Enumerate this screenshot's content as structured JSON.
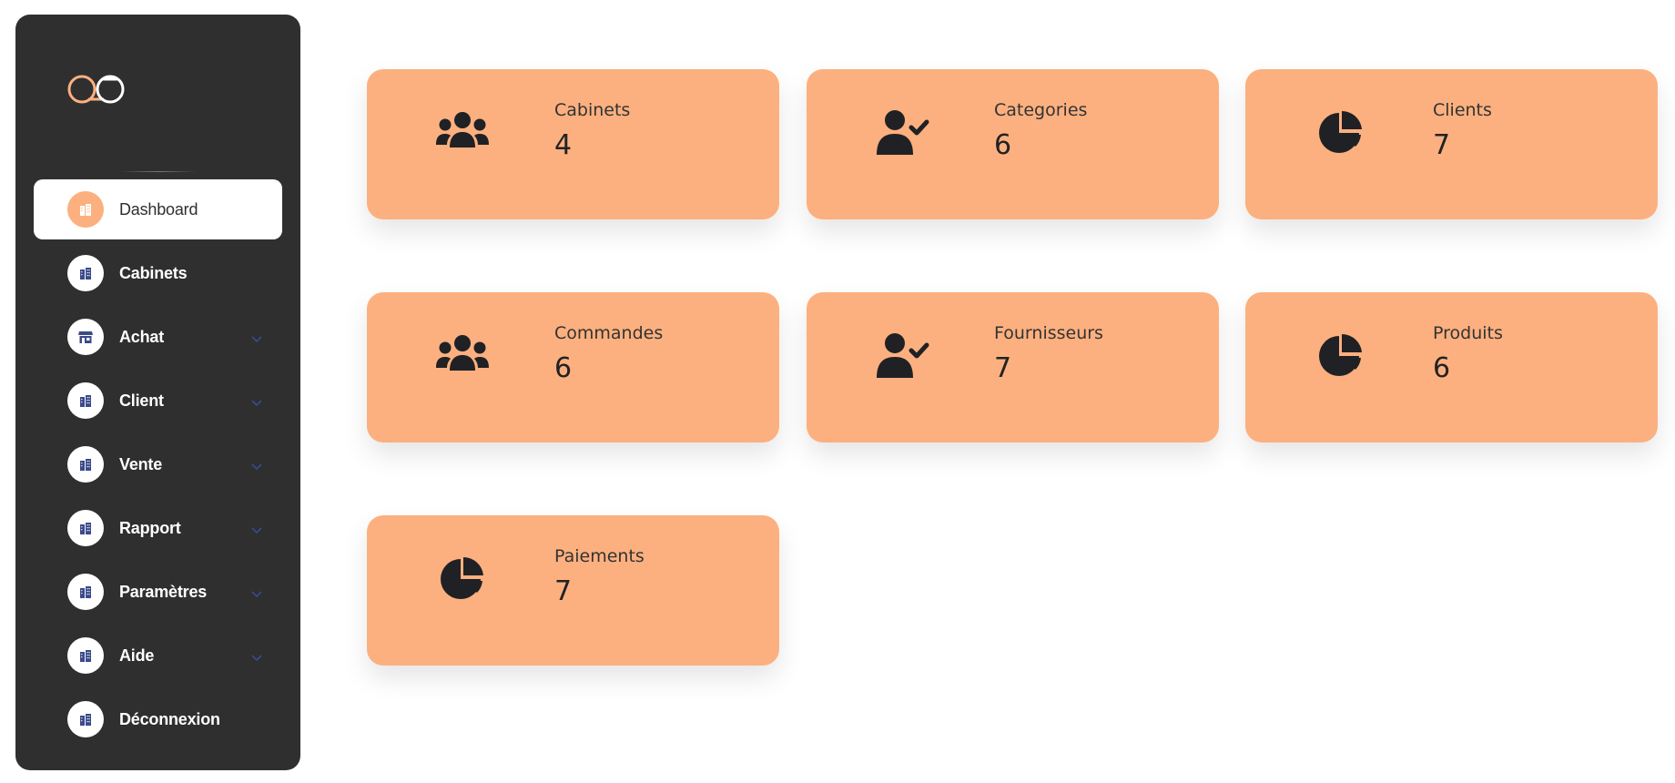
{
  "sidebar": {
    "logo_text": "QO",
    "items": [
      {
        "label": "Dashboard",
        "icon": "building-icon",
        "active": true,
        "has_chevron": false
      },
      {
        "label": "Cabinets",
        "icon": "building-icon",
        "active": false,
        "has_chevron": false
      },
      {
        "label": "Achat",
        "icon": "store-icon",
        "active": false,
        "has_chevron": true
      },
      {
        "label": "Client",
        "icon": "building-icon",
        "active": false,
        "has_chevron": true
      },
      {
        "label": "Vente",
        "icon": "building-icon",
        "active": false,
        "has_chevron": true
      },
      {
        "label": "Rapport",
        "icon": "building-icon",
        "active": false,
        "has_chevron": true
      },
      {
        "label": "Paramètres",
        "icon": "building-icon",
        "active": false,
        "has_chevron": true
      },
      {
        "label": "Aide",
        "icon": "building-icon",
        "active": false,
        "has_chevron": true
      },
      {
        "label": "Déconnexion",
        "icon": "building-icon",
        "active": false,
        "has_chevron": false
      }
    ]
  },
  "cards": [
    {
      "title": "Cabinets",
      "value": "4",
      "icon": "users-icon"
    },
    {
      "title": "Categories",
      "value": "6",
      "icon": "user-check-icon"
    },
    {
      "title": "Clients",
      "value": "7",
      "icon": "pie-chart-icon"
    },
    {
      "title": "Commandes",
      "value": "6",
      "icon": "users-icon"
    },
    {
      "title": "Fournisseurs",
      "value": "7",
      "icon": "user-check-icon"
    },
    {
      "title": "Produits",
      "value": "6",
      "icon": "pie-chart-icon"
    },
    {
      "title": "Paiements",
      "value": "7",
      "icon": "pie-chart-icon"
    }
  ],
  "colors": {
    "sidebar_bg": "#2f2f2f",
    "accent": "#fcb07f",
    "card_bg": "#fcb07f",
    "icon_dark": "#202124",
    "nav_icon_glyph": "#3b4a8a"
  }
}
